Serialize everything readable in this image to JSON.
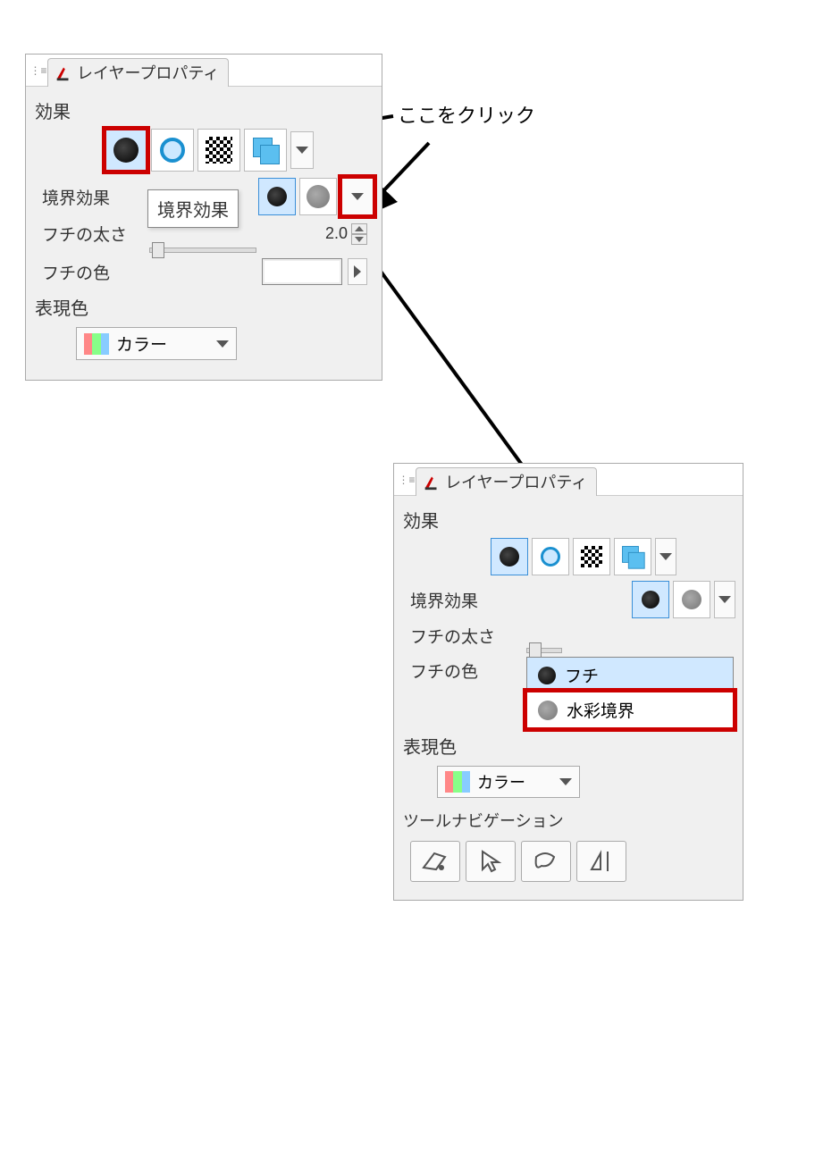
{
  "annotation": {
    "click_here": "ここをクリック"
  },
  "panel1": {
    "tab_title": "レイヤープロパティ",
    "section_effect": "効果",
    "label_border_effect": "境界効果",
    "tooltip_border_effect": "境界効果",
    "label_edge_thickness": "フチの太さ",
    "edge_thickness_value": "2.0",
    "label_edge_color": "フチの色",
    "section_expression": "表現色",
    "expression_selected": "カラー"
  },
  "panel2": {
    "tab_title": "レイヤープロパティ",
    "section_effect": "効果",
    "label_border_effect": "境界効果",
    "label_edge_thickness": "フチの太さ",
    "label_edge_color": "フチの色",
    "section_expression": "表現色",
    "expression_selected": "カラー",
    "dropdown": {
      "option_edge": "フチ",
      "option_watercolor": "水彩境界"
    },
    "section_tool_nav": "ツールナビゲーション"
  }
}
